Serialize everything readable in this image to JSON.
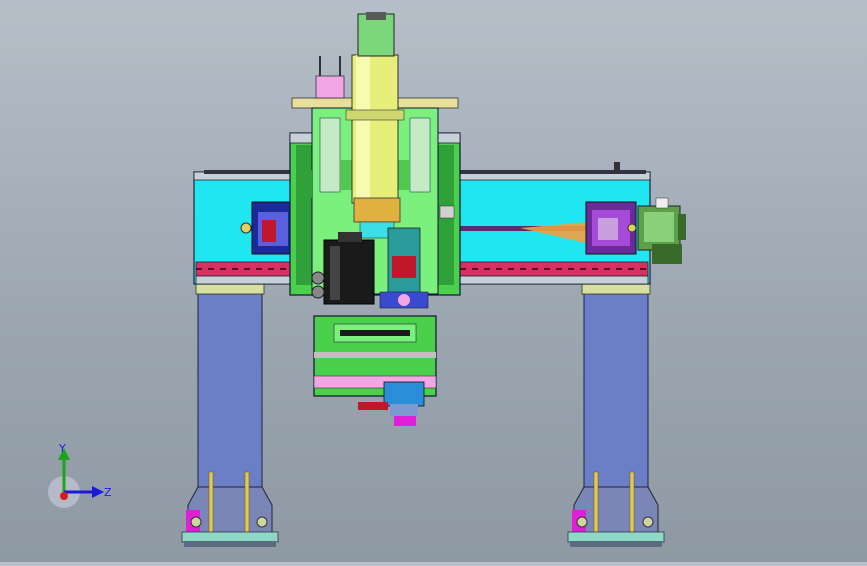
{
  "viewport": {
    "background_top": "#b5bfc8",
    "background_bottom": "#8e99a4",
    "model_colors": {
      "column": "#6b7fc6",
      "beam_cyan": "#1fe6f0",
      "saddle_green": "#7cf07c",
      "spindle_yellow": "#e7ef7a",
      "motor_black": "#1a1a1a",
      "pink_plate": "#f3a6e6",
      "magenta": "#e020d8",
      "rail_red": "#c0182a"
    }
  },
  "triad": {
    "y_label": "Y",
    "z_label": "Z",
    "icons": [
      "y-axis-arrow",
      "z-axis-arrow",
      "origin-dot"
    ]
  }
}
